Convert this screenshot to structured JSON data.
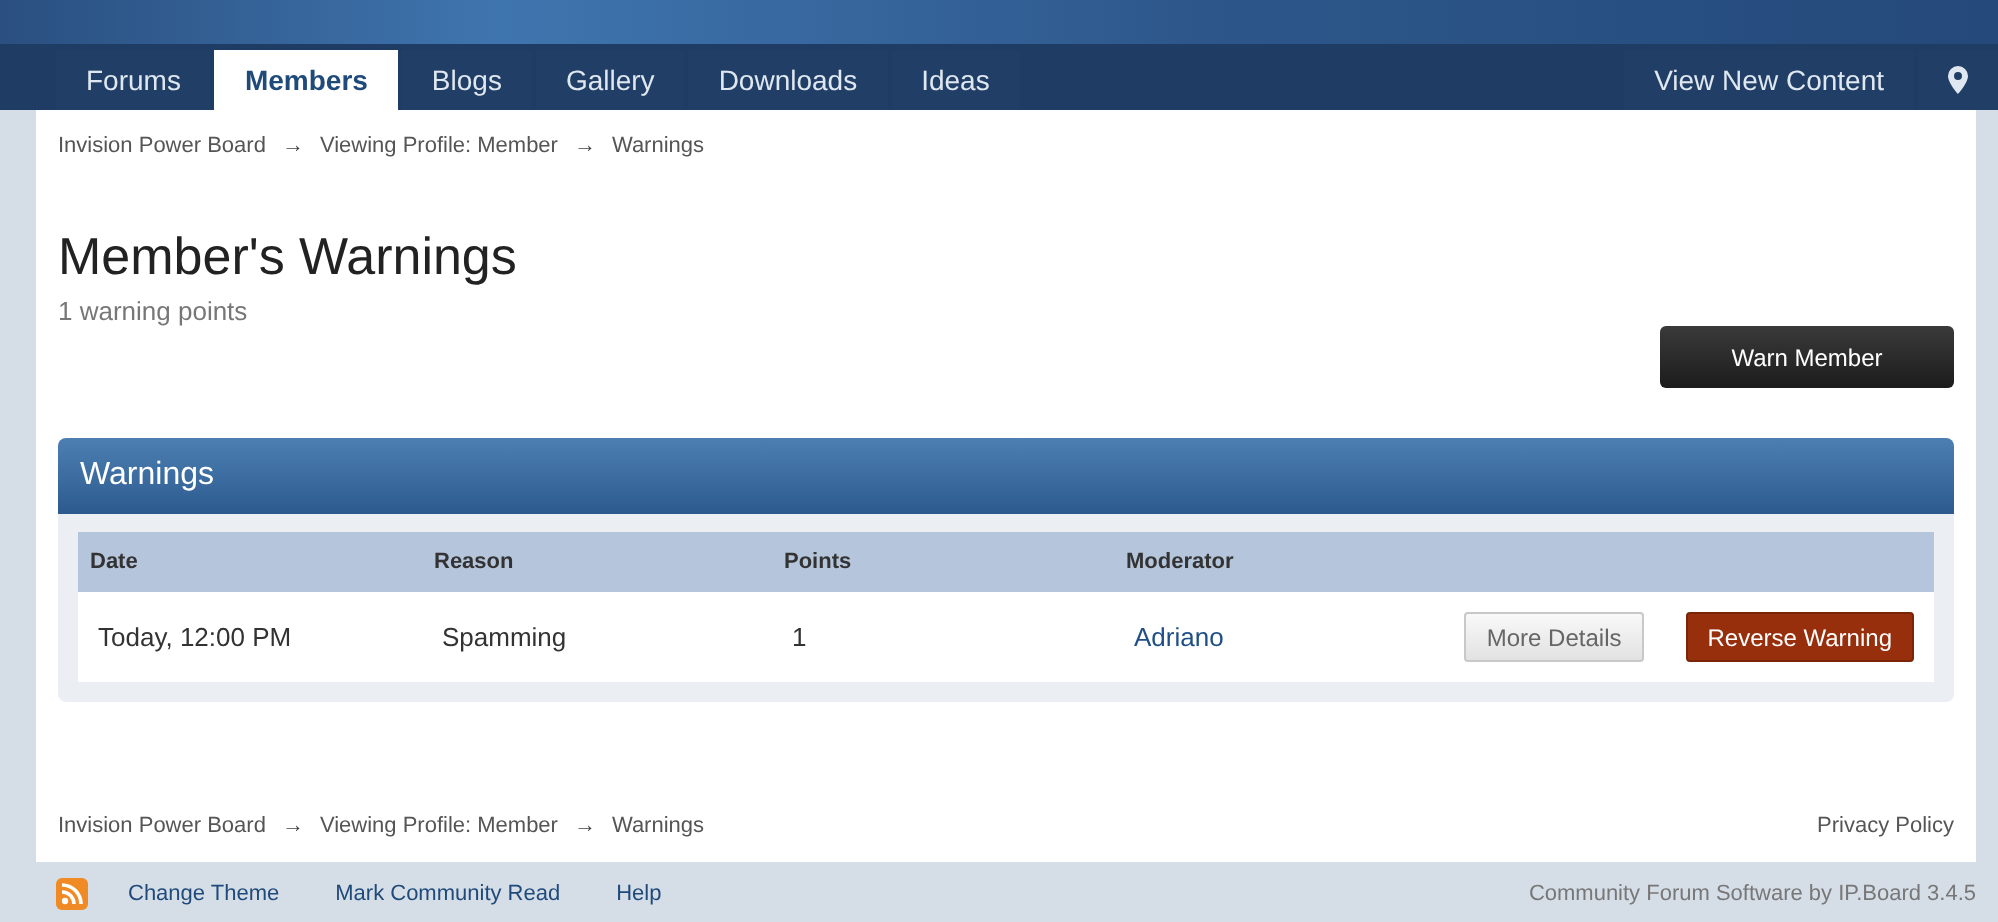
{
  "nav": {
    "tabs": [
      {
        "label": "Forums",
        "selected": false
      },
      {
        "label": "Members",
        "selected": true
      },
      {
        "label": "Blogs",
        "selected": false
      },
      {
        "label": "Gallery",
        "selected": false
      },
      {
        "label": "Downloads",
        "selected": false
      },
      {
        "label": "Ideas",
        "selected": false
      }
    ],
    "right_link": "View New Content"
  },
  "breadcrumb": [
    "Invision Power Board",
    "Viewing Profile: Member",
    "Warnings"
  ],
  "breadcrumb_separator": "→",
  "title": "Member's Warnings",
  "subtitle": "1 warning points",
  "warn_button": "Warn Member",
  "warnings": {
    "title": "Warnings",
    "columns": [
      "Date",
      "Reason",
      "Points",
      "Moderator"
    ],
    "rows": [
      {
        "date": "Today, 12:00 PM",
        "reason": "Spamming",
        "points": "1",
        "moderator": "Adriano",
        "details_button": "More Details",
        "reverse_button": "Reverse Warning"
      }
    ]
  },
  "footer_breadcrumb": [
    "Invision Power Board",
    "Viewing Profile: Member",
    "Warnings"
  ],
  "privacy": "Privacy Policy",
  "footer_links": [
    "Change Theme",
    "Mark Community Read",
    "Help"
  ],
  "copyright": "Community Forum Software by IP.Board 3.4.5"
}
